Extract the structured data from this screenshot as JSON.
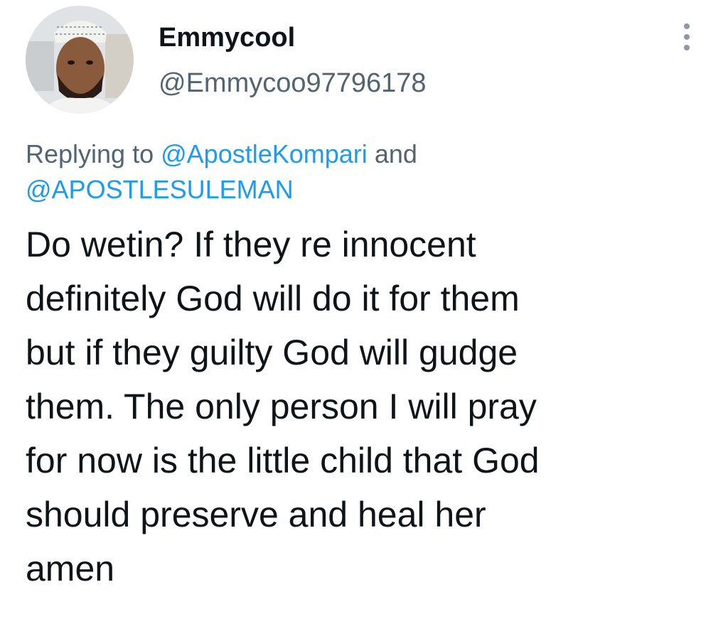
{
  "author": {
    "display_name": "Emmycool",
    "handle": "@Emmycoo97796178",
    "avatar_icon": "profile-photo"
  },
  "more_icon": "more-vertical-icon",
  "reply": {
    "prefix": "Replying to",
    "mentions": [
      "@ApostleKompari",
      "@APOSTLESULEMAN"
    ],
    "connector": "and"
  },
  "tweet": {
    "lines": [
      "Do wetin? If they re innocent",
      "definitely God will do it for them",
      "but if they guilty God will gudge",
      "them. The only person I will pray",
      "for now is the little child that God",
      "should preserve and heal her",
      "amen"
    ]
  },
  "colors": {
    "text": "#0f1419",
    "secondary": "#536471",
    "accent": "#1d9bf0"
  }
}
